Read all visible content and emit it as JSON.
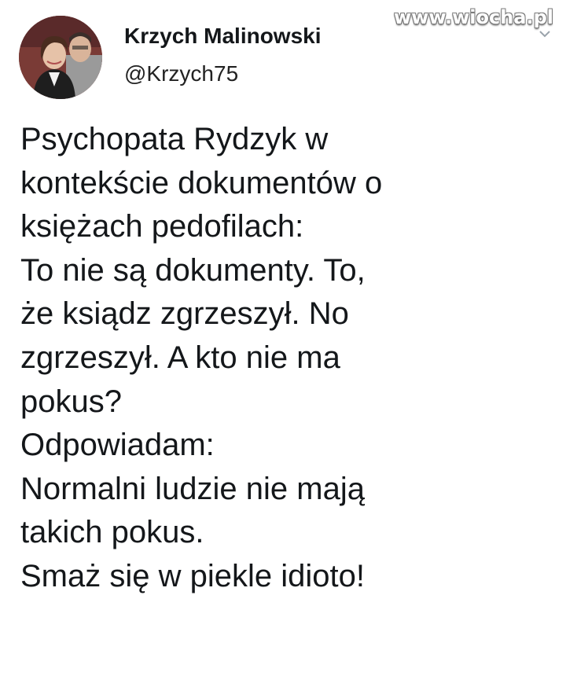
{
  "watermark": "www.wiocha.pl",
  "author": {
    "display_name": "Krzych Malinowski",
    "handle": "@Krzych75"
  },
  "tweet": {
    "lines": [
      "Psychopata Rydzyk w",
      "kontekście dokumentów o",
      "księżach pedofilach:",
      "To nie są dokumenty. To,",
      "że ksiądz zgrzeszył. No",
      "zgrzeszył. A kto nie ma",
      "pokus?",
      "Odpowiadam:",
      "Normalni ludzie nie mają",
      "takich pokus.",
      "Smaż się w piekle idioto!"
    ]
  },
  "icons": {
    "caret": "chevron-down-icon",
    "avatar": "avatar"
  },
  "colors": {
    "text": "#14171a",
    "background": "#ffffff"
  }
}
